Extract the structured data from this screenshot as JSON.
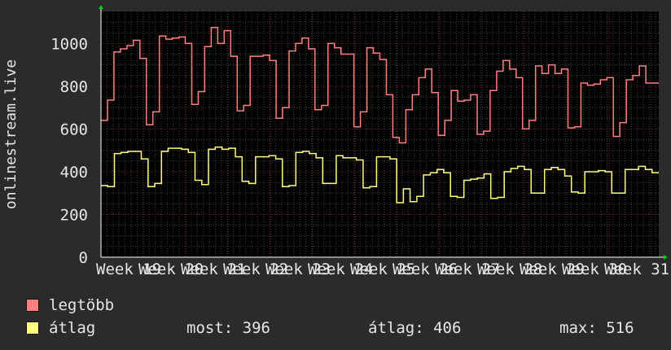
{
  "chart_data": {
    "type": "line",
    "ylabel": "onlinestream.live",
    "ylim": [
      0,
      1150
    ],
    "yticks": [
      0,
      200,
      400,
      600,
      800,
      1000
    ],
    "x_tick_labels": [
      "Week 19",
      "Week 20",
      "Week 21",
      "Week 22",
      "Week 23",
      "Week 24",
      "Week 25",
      "Week 26",
      "Week 27",
      "Week 28",
      "Week 29",
      "Week 30",
      "Week 31"
    ],
    "grid": true,
    "series": [
      {
        "name": "legtöbb",
        "color": "#ff7f7f",
        "values": [
          640,
          735,
          960,
          975,
          990,
          1015,
          930,
          620,
          680,
          1035,
          1020,
          1025,
          1030,
          1000,
          715,
          775,
          985,
          1075,
          1000,
          1060,
          940,
          685,
          710,
          940,
          940,
          945,
          920,
          650,
          700,
          965,
          1000,
          1025,
          975,
          690,
          710,
          1000,
          980,
          950,
          950,
          610,
          680,
          980,
          955,
          925,
          760,
          560,
          535,
          690,
          760,
          840,
          880,
          770,
          570,
          640,
          780,
          730,
          735,
          760,
          575,
          590,
          780,
          870,
          920,
          880,
          840,
          600,
          640,
          895,
          860,
          900,
          860,
          880,
          605,
          610,
          815,
          805,
          810,
          830,
          840,
          565,
          630,
          830,
          850,
          895,
          815,
          815
        ]
      },
      {
        "name": "átlag",
        "color": "#ffff7f",
        "values": [
          335,
          330,
          485,
          490,
          495,
          495,
          460,
          330,
          345,
          495,
          510,
          510,
          505,
          490,
          360,
          340,
          505,
          515,
          505,
          510,
          470,
          355,
          345,
          470,
          470,
          475,
          460,
          330,
          335,
          490,
          495,
          485,
          465,
          345,
          345,
          475,
          465,
          465,
          455,
          325,
          330,
          470,
          470,
          460,
          255,
          320,
          260,
          285,
          385,
          395,
          410,
          395,
          285,
          280,
          360,
          365,
          370,
          390,
          275,
          280,
          400,
          415,
          425,
          410,
          300,
          300,
          410,
          420,
          410,
          380,
          305,
          300,
          400,
          400,
          405,
          400,
          300,
          300,
          410,
          410,
          425,
          410,
          395
        ]
      }
    ]
  },
  "legend": [
    {
      "label": "legtöbb",
      "color": "#ff7f7f"
    },
    {
      "label": "átlag",
      "color": "#ffff7f"
    }
  ],
  "stats": {
    "most": "most: 396",
    "atlag": "átlag: 406",
    "max": "max: 516"
  }
}
